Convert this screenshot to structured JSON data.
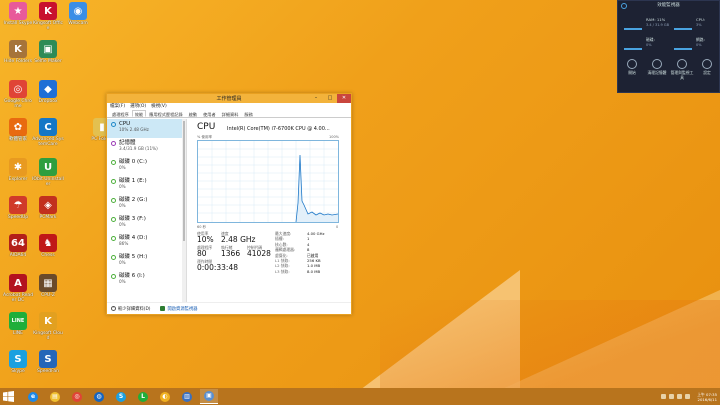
{
  "desktop": {
    "icons": [
      {
        "label": "Install Skype",
        "color": "#e85a9a",
        "glyph": "★"
      },
      {
        "label": "Kingsoft Office",
        "color": "#c8102e",
        "glyph": "K"
      },
      {
        "label": "Webcam",
        "color": "#3a8ee6",
        "glyph": "◉"
      },
      {
        "label": "Hide Folders",
        "color": "#a6743a",
        "glyph": "K"
      },
      {
        "label": "Selfie Maker",
        "color": "#2e8b57",
        "glyph": "▣"
      },
      {
        "label": "Google Chrome",
        "color": "#e04436",
        "glyph": "◎"
      },
      {
        "label": "Dropbox",
        "color": "#1f6fd6",
        "glyph": "◆"
      },
      {
        "label": "軟體管家",
        "color": "#e86a10",
        "glyph": "✿"
      },
      {
        "label": "Advanced SystemCare",
        "color": "#1577c6",
        "glyph": "C"
      },
      {
        "label": "PC Folder",
        "color": "#e3c050",
        "glyph": "▮"
      },
      {
        "label": "Explorer",
        "color": "#e89a20",
        "glyph": "✱"
      },
      {
        "label": "IObit Uninstaller",
        "color": "#2f9e3f",
        "glyph": "U"
      },
      {
        "label": "SpeedUp",
        "color": "#d03a2a",
        "glyph": "☂"
      },
      {
        "label": "PCMark",
        "color": "#c2301e",
        "glyph": "◈"
      },
      {
        "label": "AIDA64",
        "color": "#b3201a",
        "glyph": "64"
      },
      {
        "label": "Chess",
        "color": "#c01818",
        "glyph": "♞"
      },
      {
        "label": "Acrobat Reader DC",
        "color": "#b3121f",
        "glyph": "A"
      },
      {
        "label": "CPU-Z",
        "color": "#6a4a2a",
        "glyph": "▦"
      },
      {
        "label": "LINE",
        "color": "#1fae3a",
        "glyph": "LINE"
      },
      {
        "label": "Kingsoft Cloud",
        "color": "#e2a020",
        "glyph": "K"
      },
      {
        "label": "Skype",
        "color": "#1ba0e0",
        "glyph": "S"
      },
      {
        "label": "SpeedFan",
        "color": "#2466b8",
        "glyph": "S"
      }
    ]
  },
  "taskmanager": {
    "title": "工作管理員",
    "menu": [
      "檔案(F)",
      "選項(O)",
      "檢視(V)"
    ],
    "tabs": [
      "處理程序",
      "效能",
      "應用程式歷程記錄",
      "啟動",
      "使用者",
      "詳細資料",
      "服務"
    ],
    "active_tab": "效能",
    "sidebar": [
      {
        "name": "CPU",
        "detail": "10% 2.48 GHz",
        "kind": "cpu"
      },
      {
        "name": "記憶體",
        "detail": "3.4/31.9 GB (11%)",
        "kind": "mem"
      },
      {
        "name": "磁碟 0 (C:)",
        "detail": "0%",
        "kind": "disk"
      },
      {
        "name": "磁碟 1 (E:)",
        "detail": "0%",
        "kind": "disk"
      },
      {
        "name": "磁碟 2 (G:)",
        "detail": "0%",
        "kind": "disk"
      },
      {
        "name": "磁碟 3 (F:)",
        "detail": "0%",
        "kind": "disk"
      },
      {
        "name": "磁碟 4 (D:)",
        "detail": "86%",
        "kind": "disk"
      },
      {
        "name": "磁碟 5 (H:)",
        "detail": "0%",
        "kind": "disk"
      },
      {
        "name": "磁碟 6 (I:)",
        "detail": "0%",
        "kind": "disk"
      }
    ],
    "cpu": {
      "heading": "CPU",
      "model": "Intel(R) Core(TM) i7-6700K CPU @ 4.00...",
      "util_label": "% 使用率",
      "max_label": "100%",
      "time_label": "60 秒",
      "zero_label": "0",
      "usage_label": "使用率",
      "usage_value": "10%",
      "speed_label": "速度",
      "speed_value": "2.48 GHz",
      "proc_label": "處理程序",
      "proc_value": "80",
      "threads_label": "執行緒",
      "threads_value": "1366",
      "handles_label": "控制代碼",
      "handles_value": "41028",
      "uptime_label": "運作時間",
      "uptime_value": "0:00:33:48",
      "specs": [
        {
          "k": "最大速度:",
          "v": "4.00 GHz"
        },
        {
          "k": "插槽:",
          "v": "1"
        },
        {
          "k": "核心數:",
          "v": "4"
        },
        {
          "k": "邏輯處理器:",
          "v": "8"
        },
        {
          "k": "虛擬化:",
          "v": "已啟用"
        },
        {
          "k": "L1 快取:",
          "v": "256 KB"
        },
        {
          "k": "L2 快取:",
          "v": "1.0 MB"
        },
        {
          "k": "L3 快取:",
          "v": "8.0 MB"
        }
      ]
    },
    "footer": {
      "fewer": "較少詳細資料(D)",
      "open": "開啟資源監視器"
    }
  },
  "perfmon": {
    "title": "效能監視器",
    "cells": [
      {
        "k": "RAM: 11%",
        "v": "3.4 / 31.9 GB"
      },
      {
        "k": "CPU:",
        "v": "3%"
      },
      {
        "k": "磁碟:",
        "v": "0%"
      },
      {
        "k": "網路:",
        "v": "0%"
      }
    ],
    "buttons": [
      "開始",
      "清理記憶體",
      "管理與監視工具",
      "設定"
    ]
  },
  "taskbar": {
    "apps": [
      {
        "glyph": "e",
        "color": "#1e88e5"
      },
      {
        "glyph": "▤",
        "color": "#f0c030"
      },
      {
        "glyph": "◎",
        "color": "#e04436"
      },
      {
        "glyph": "◍",
        "color": "#1565c0"
      },
      {
        "glyph": "S",
        "color": "#1ba0e0"
      },
      {
        "glyph": "L",
        "color": "#1fae3a"
      },
      {
        "glyph": "◐",
        "color": "#f0b020"
      },
      {
        "glyph": "▥",
        "color": "#3a70c0"
      },
      {
        "glyph": "▣",
        "color": "#5a8fd0"
      }
    ],
    "time": "上午 07:35",
    "date": "2016/6/11"
  }
}
